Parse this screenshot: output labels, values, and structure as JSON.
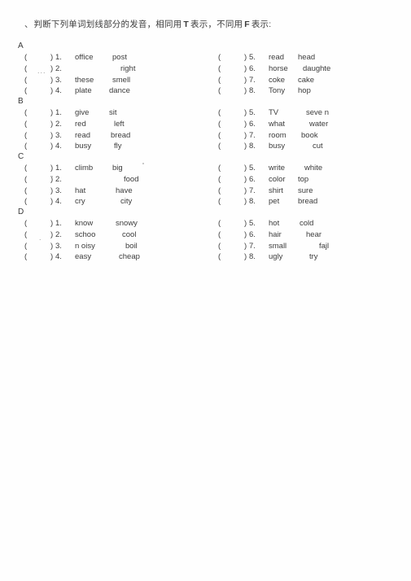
{
  "instruction": {
    "lead": "、",
    "text_before_t": "判断下列单词划线部分的发音，相同用",
    "t_mark": "T",
    "text_mid": "表示，不同用",
    "f_mark": "F",
    "text_after": "表示:"
  },
  "sections": [
    {
      "letter": "A",
      "left_rows": [
        {
          "paren_open": "(",
          "paren_close": ")",
          "num": "1.",
          "word1": "office",
          "word2": "post"
        },
        {
          "paren_open": "(",
          "paren_close": ")",
          "num": "2.",
          "word1": "",
          "word2": "right"
        },
        {
          "paren_open": "(",
          "paren_close": ")",
          "num": "3.",
          "word1": "these",
          "word2": "smell"
        },
        {
          "paren_open": "(",
          "paren_close": ")",
          "num": "4.",
          "word1": "plate",
          "word2": "dance"
        }
      ],
      "right_rows": [
        {
          "paren_open": "(",
          "paren_close": ")",
          "num": "5.",
          "word1": "read",
          "word2": "head"
        },
        {
          "paren_open": "(",
          "paren_close": ")",
          "num": "6.",
          "word1": "horse",
          "word2": "daughte"
        },
        {
          "paren_open": "(",
          "paren_close": ")",
          "num": "7.",
          "word1": "coke",
          "word2": "cake"
        },
        {
          "paren_open": "(",
          "paren_close": ")",
          "num": "8.",
          "word1": "Tony",
          "word2": "hop"
        }
      ]
    },
    {
      "letter": "B",
      "left_rows": [
        {
          "paren_open": "(",
          "paren_close": ")",
          "num": "1.",
          "word1": "give",
          "word2": "sit"
        },
        {
          "paren_open": "(",
          "paren_close": ")",
          "num": "2.",
          "word1": "red",
          "word2": "left"
        },
        {
          "paren_open": "(",
          "paren_close": ")",
          "num": "3.",
          "word1": "read",
          "word2": "bread"
        },
        {
          "paren_open": "(",
          "paren_close": ")",
          "num": "4.",
          "word1": "busy",
          "word2": "fly"
        }
      ],
      "right_rows": [
        {
          "paren_open": "(",
          "paren_close": ")",
          "num": "5.",
          "word1": "TV",
          "word2": "seve n"
        },
        {
          "paren_open": "(",
          "paren_close": ")",
          "num": "6.",
          "word1": "what",
          "word2": "water"
        },
        {
          "paren_open": "(",
          "paren_close": ")",
          "num": "7.",
          "word1": "room",
          "word2": "book"
        },
        {
          "paren_open": "(",
          "paren_close": ")",
          "num": "8.",
          "word1": "busy",
          "word2": "cut"
        }
      ]
    },
    {
      "letter": "C",
      "left_rows": [
        {
          "paren_open": "(",
          "paren_close": ")",
          "num": "1.",
          "word1": "climb",
          "word2": "big"
        },
        {
          "paren_open": "(",
          "paren_close": ")",
          "num": "2.",
          "word1": "",
          "word2": "food"
        },
        {
          "paren_open": "(",
          "paren_close": ")",
          "num": "3.",
          "word1": "hat",
          "word2": "have"
        },
        {
          "paren_open": "(",
          "paren_close": ")",
          "num": "4.",
          "word1": "cry",
          "word2": "city"
        }
      ],
      "right_rows": [
        {
          "paren_open": "(",
          "paren_close": ")",
          "num": "5.",
          "word1": "write",
          "word2": "white"
        },
        {
          "paren_open": "(",
          "paren_close": ")",
          "num": "6.",
          "word1": "color",
          "word2": "top"
        },
        {
          "paren_open": "(",
          "paren_close": ")",
          "num": "7.",
          "word1": "shirt",
          "word2": "sure"
        },
        {
          "paren_open": "(",
          "paren_close": ")",
          "num": "8.",
          "word1": "pet",
          "word2": "bread"
        }
      ]
    },
    {
      "letter": "D",
      "left_rows": [
        {
          "paren_open": "(",
          "paren_close": ")",
          "num": "1.",
          "word1": "know",
          "word2": "snowy"
        },
        {
          "paren_open": "(",
          "paren_close": ")",
          "num": "2.",
          "word1": "schoo",
          "word2": "cool"
        },
        {
          "paren_open": "(",
          "paren_close": ")",
          "num": "3.",
          "word1": "n oisy",
          "word2": "boil"
        },
        {
          "paren_open": "(",
          "paren_close": ")",
          "num": "4.",
          "word1": "easy",
          "word2": "cheap"
        }
      ],
      "right_rows": [
        {
          "paren_open": "(",
          "paren_close": ")",
          "num": "5.",
          "word1": "hot",
          "word2": "cold"
        },
        {
          "paren_open": "(",
          "paren_close": ")",
          "num": "6.",
          "word1": "hair",
          "word2": "hear"
        },
        {
          "paren_open": "(",
          "paren_close": ")",
          "num": "7.",
          "word1": "small",
          "word2": "fajl"
        },
        {
          "paren_open": "(",
          "paren_close": ")",
          "num": "8.",
          "word1": "ugly",
          "word2": "try"
        }
      ]
    }
  ],
  "artifacts": {
    "smudge_a": "...",
    "smudge_d": "."
  }
}
